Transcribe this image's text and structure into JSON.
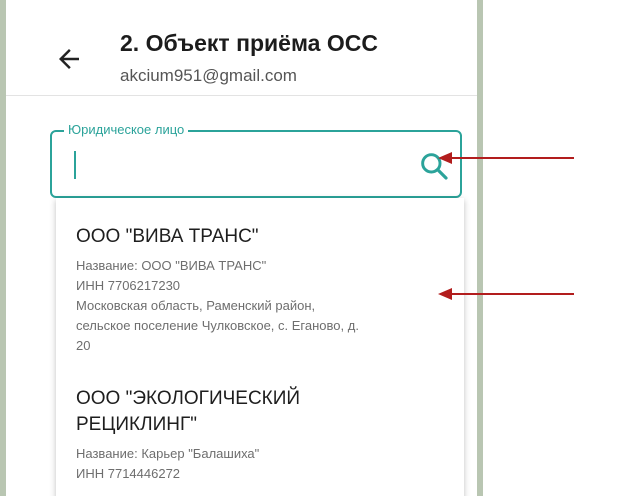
{
  "header": {
    "title": "2. Объект приёма ОСС",
    "subtitle": "akcium951@gmail.com"
  },
  "field": {
    "label": "Юридическое лицо",
    "value": ""
  },
  "results": [
    {
      "title": "ООО \"ВИВА ТРАНС\"",
      "name": "Название: ООО \"ВИВА ТРАНС\"",
      "inn": "ИНН 7706217230",
      "address_lines": [
        "Московская область, Раменский район,",
        "сельское поселение Чулковское, с. Еганово, д.",
        "20"
      ]
    },
    {
      "title_lines": [
        "ООО \"ЭКОЛОГИЧЕСКИЙ",
        "РЕЦИКЛИНГ\""
      ],
      "name": "Название: Карьер \"Балашиха\"",
      "inn": "ИНН 7714446272"
    }
  ],
  "colors": {
    "accent": "#2ba39a",
    "annotation_arrow": "#b21d1d"
  }
}
